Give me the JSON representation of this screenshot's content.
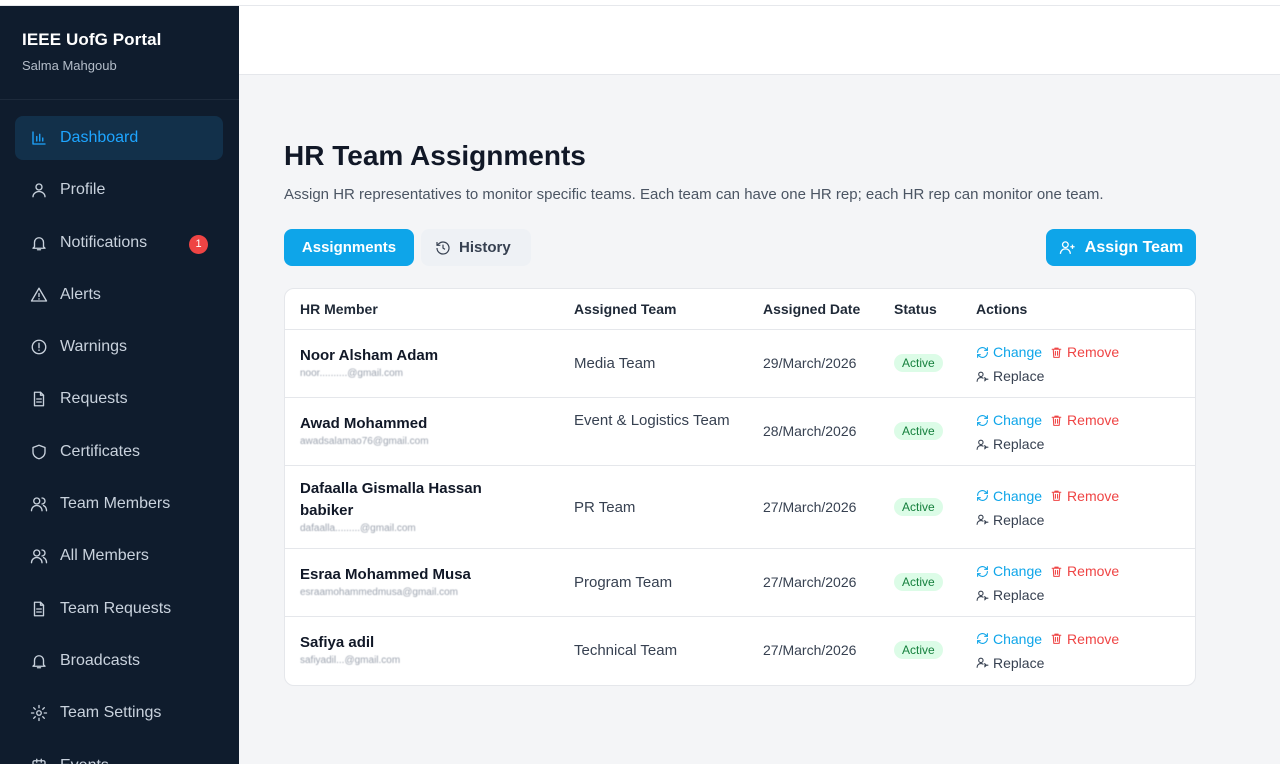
{
  "app": {
    "title": "IEEE UofG Portal",
    "user": "Salma Mahgoub"
  },
  "sidebar": {
    "items": [
      {
        "label": "Dashboard",
        "icon": "bar-chart-icon",
        "active": true
      },
      {
        "label": "Profile",
        "icon": "user-icon"
      },
      {
        "label": "Notifications",
        "icon": "bell-icon",
        "badge": "1"
      },
      {
        "label": "Alerts",
        "icon": "triangle-alert-icon"
      },
      {
        "label": "Warnings",
        "icon": "circle-alert-icon"
      },
      {
        "label": "Requests",
        "icon": "file-icon"
      },
      {
        "label": "Certificates",
        "icon": "shield-icon"
      },
      {
        "label": "Team Members",
        "icon": "users-icon"
      },
      {
        "label": "All Members",
        "icon": "users-icon"
      },
      {
        "label": "Team Requests",
        "icon": "file-icon"
      },
      {
        "label": "Broadcasts",
        "icon": "bell-icon"
      },
      {
        "label": "Team Settings",
        "icon": "gear-icon"
      },
      {
        "label": "Events",
        "icon": "calendar-icon"
      }
    ]
  },
  "main": {
    "title": "HR Team Assignments",
    "subtitle": "Assign HR representatives to monitor specific teams. Each team can have one HR rep; each HR rep can monitor one team.",
    "tabs": {
      "assignments": "Assignments",
      "history": "History"
    },
    "assign_button": "Assign Team",
    "table": {
      "headers": {
        "member": "HR Member",
        "team": "Assigned Team",
        "date": "Assigned Date",
        "status": "Status",
        "actions": "Actions"
      },
      "action_labels": {
        "change": "Change",
        "remove": "Remove",
        "replace": "Replace"
      },
      "rows": [
        {
          "name": "Noor Alsham Adam",
          "email": "noor..........@gmail.com",
          "team": "Media Team",
          "date": "29/March/2026",
          "status": "Active"
        },
        {
          "name": "Awad Mohammed",
          "email": "awadsalamao76@gmail.com",
          "team": "Event & Logistics Team",
          "date": "28/March/2026",
          "status": "Active"
        },
        {
          "name": "Dafaalla Gismalla Hassan babiker",
          "email": "dafaalla.........@gmail.com",
          "team": "PR Team",
          "date": "27/March/2026",
          "status": "Active"
        },
        {
          "name": "Esraa Mohammed Musa",
          "email": "esraamohammedmusa@gmail.com",
          "team": "Program Team",
          "date": "27/March/2026",
          "status": "Active"
        },
        {
          "name": "Safiya adil",
          "email": "safiyadil...@gmail.com",
          "team": "Technical Team",
          "date": "27/March/2026",
          "status": "Active"
        }
      ]
    }
  }
}
